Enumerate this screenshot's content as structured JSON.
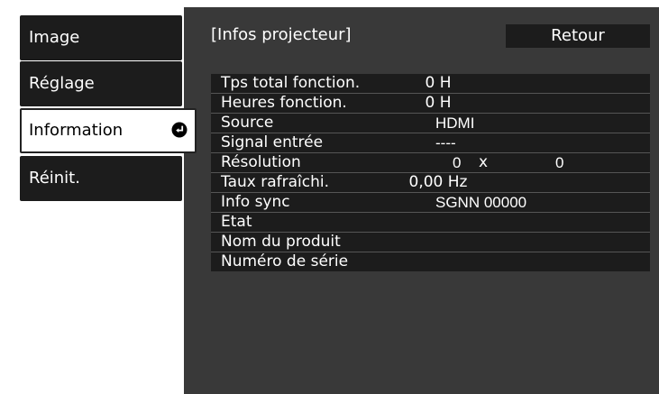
{
  "sidebar": {
    "items": [
      {
        "label": "Image"
      },
      {
        "label": "Réglage"
      },
      {
        "label": "Information"
      },
      {
        "label": "Réinit."
      }
    ],
    "selected_icon": "enter-arrow-icon"
  },
  "panel": {
    "title": "[Infos projecteur]",
    "back_label": "Retour"
  },
  "info": {
    "total_hours": {
      "label": "Tps total fonction.",
      "value": "0 H"
    },
    "op_hours": {
      "label": "Heures fonction.",
      "value": "0 H"
    },
    "source": {
      "label": "Source",
      "value": "HDMI"
    },
    "input_signal": {
      "label": "Signal entrée",
      "value": "----"
    },
    "resolution": {
      "label": "Résolution",
      "width": "0",
      "sep": "x",
      "height": "0"
    },
    "refresh_rate": {
      "label": "Taux rafraîchi.",
      "value": "0,00 Hz"
    },
    "sync_info": {
      "label": "Info sync",
      "value": "SGNN 00000"
    },
    "status": {
      "label": "Etat",
      "value": ""
    },
    "product_name": {
      "label": "Nom du produit",
      "value": ""
    },
    "serial_number": {
      "label": "Numéro de série",
      "value": ""
    }
  },
  "colors": {
    "panel_bg": "#393939",
    "item_bg": "#1c1c1c",
    "text": "#ffffff",
    "selected_bg": "#ffffff"
  }
}
